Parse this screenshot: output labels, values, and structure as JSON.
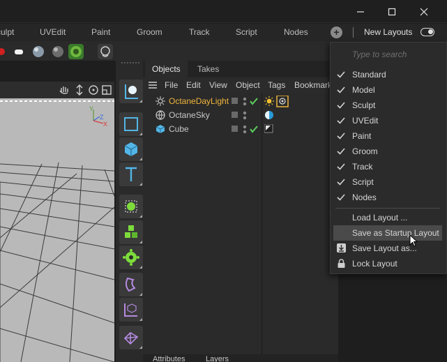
{
  "layout_tabs": [
    "Sculpt",
    "UVEdit",
    "Paint",
    "Groom",
    "Track",
    "Script",
    "Nodes"
  ],
  "new_layouts_label": "New Layouts",
  "object_manager": {
    "tabs": [
      "Objects",
      "Takes"
    ],
    "menu": [
      "File",
      "Edit",
      "View",
      "Object",
      "Tags",
      "Bookmarks"
    ],
    "objects": [
      {
        "name": "OctaneDayLight",
        "color": "#f0b63c"
      },
      {
        "name": "OctaneSky",
        "color": "#c8c8c8"
      },
      {
        "name": "Cube",
        "color": "#c8c8c8"
      }
    ]
  },
  "attributes_tabs": [
    "Attributes",
    "Layers"
  ],
  "dropdown": {
    "search_placeholder": "Type to search",
    "layouts": [
      {
        "label": "Standard",
        "checked": true
      },
      {
        "label": "Model",
        "checked": true
      },
      {
        "label": "Sculpt",
        "checked": true
      },
      {
        "label": "UVEdit",
        "checked": true
      },
      {
        "label": "Paint",
        "checked": true
      },
      {
        "label": "Groom",
        "checked": true
      },
      {
        "label": "Track",
        "checked": true
      },
      {
        "label": "Script",
        "checked": true
      },
      {
        "label": "Nodes",
        "checked": true
      }
    ],
    "actions": [
      {
        "label": "Load Layout ...",
        "icon": ""
      },
      {
        "label": "Save as Startup Layout",
        "icon": "",
        "highlighted": true
      },
      {
        "label": "Save Layout as...",
        "icon": "download-icon"
      },
      {
        "label": "Lock Layout",
        "icon": "lock-icon"
      }
    ]
  },
  "colors": {
    "accent_green": "#5bd15b",
    "active_object": "#f0b63c",
    "palette_icon_blue": "#53b6e8",
    "palette_icon_green": "#7ddc3c",
    "palette_icon_purple": "#b58ae0"
  }
}
